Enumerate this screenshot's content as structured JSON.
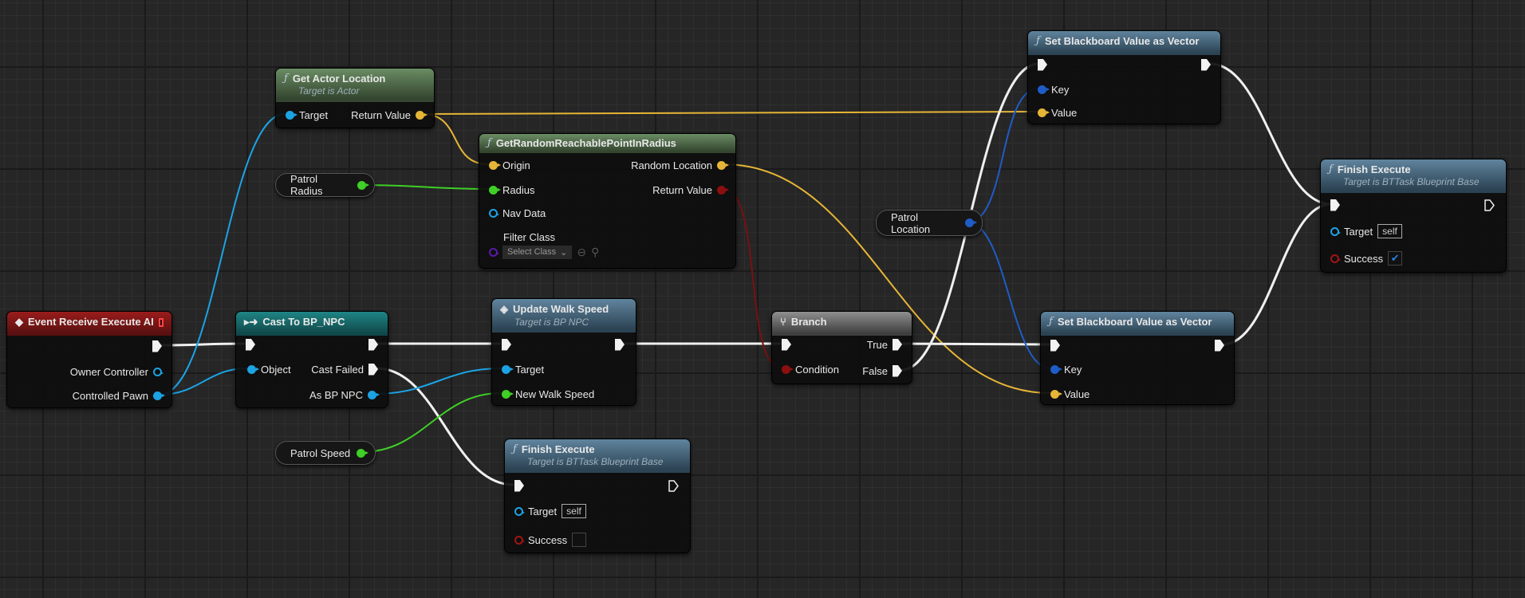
{
  "colors": {
    "exec": "#f0f0f0",
    "object": "#1ca3e4",
    "vector": "#e6b536",
    "float": "#3fcf26",
    "bool": "#8c0f0f",
    "key": "#1f5cc6",
    "class": "#5a1aa8"
  },
  "nodes": {
    "event": {
      "title": "Event Receive Execute AI",
      "pins": [
        "Owner Controller",
        "Controlled Pawn"
      ]
    },
    "cast": {
      "title": "Cast To BP_NPC",
      "pins": [
        "Object",
        "Cast Failed",
        "As BP NPC"
      ]
    },
    "get_actor": {
      "title": "Get Actor Location",
      "subtitle": "Target is Actor",
      "pins": [
        "Target",
        "Return Value"
      ]
    },
    "random_point": {
      "title": "GetRandomReachablePointInRadius",
      "pins": [
        "Origin",
        "Radius",
        "Nav Data",
        "Filter Class",
        "Random Location",
        "Return Value"
      ],
      "select_class": "Select Class"
    },
    "patrol_radius": {
      "title": "Patrol Radius"
    },
    "patrol_speed": {
      "title": "Patrol Speed"
    },
    "patrol_location": {
      "title": "Patrol Location"
    },
    "update_walk": {
      "title": "Update Walk Speed",
      "subtitle": "Target is BP NPC",
      "pins": [
        "Target",
        "New Walk Speed"
      ]
    },
    "finish_fail": {
      "title": "Finish Execute",
      "subtitle": "Target is BTTask Blueprint Base",
      "pins": [
        "Target",
        "Success"
      ],
      "target_value": "self",
      "success": false
    },
    "branch": {
      "title": "Branch",
      "pins": [
        "Condition",
        "True",
        "False"
      ]
    },
    "sbv_top": {
      "title": "Set Blackboard Value as Vector",
      "pins": [
        "Key",
        "Value"
      ]
    },
    "sbv_bottom": {
      "title": "Set Blackboard Value as Vector",
      "pins": [
        "Key",
        "Value"
      ]
    },
    "finish_ok": {
      "title": "Finish Execute",
      "subtitle": "Target is BTTask Blueprint Base",
      "pins": [
        "Target",
        "Success"
      ],
      "target_value": "self",
      "success": true
    }
  }
}
